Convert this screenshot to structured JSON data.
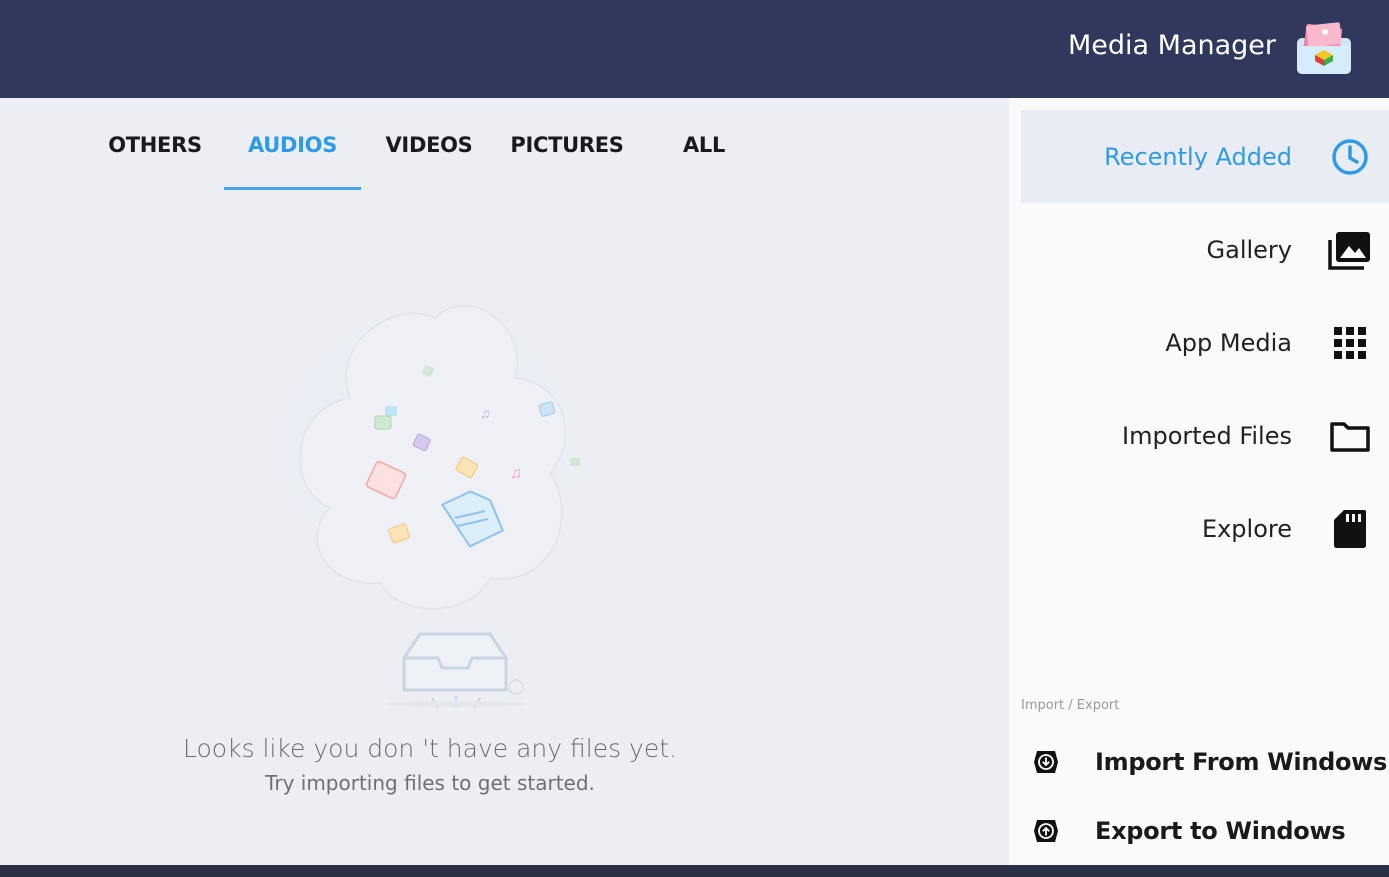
{
  "header": {
    "title": "Media Manager"
  },
  "tabs": [
    {
      "label": "OTHERS",
      "active": false
    },
    {
      "label": "AUDIOS",
      "active": true
    },
    {
      "label": "VIDEOS",
      "active": false
    },
    {
      "label": "PICTURES",
      "active": false
    },
    {
      "label": "ALL",
      "active": false
    }
  ],
  "empty_state": {
    "line1": "Looks like you don 't have any files yet.",
    "line2": "Try importing files to get started."
  },
  "sidebar": {
    "items": [
      {
        "label": "Recently Added",
        "icon": "clock-icon",
        "active": true
      },
      {
        "label": "Gallery",
        "icon": "gallery-icon",
        "active": false
      },
      {
        "label": "App Media",
        "icon": "grid-icon",
        "active": false
      },
      {
        "label": "Imported Files",
        "icon": "folder-icon",
        "active": false
      },
      {
        "label": "Explore",
        "icon": "sd-card-icon",
        "active": false
      }
    ],
    "section_label": "Import / Export",
    "import_label": "Import From Windows",
    "export_label": "Export to Windows"
  },
  "colors": {
    "header": "#30385d",
    "accent": "#2e9bea",
    "highlight": "#f4f42a"
  }
}
